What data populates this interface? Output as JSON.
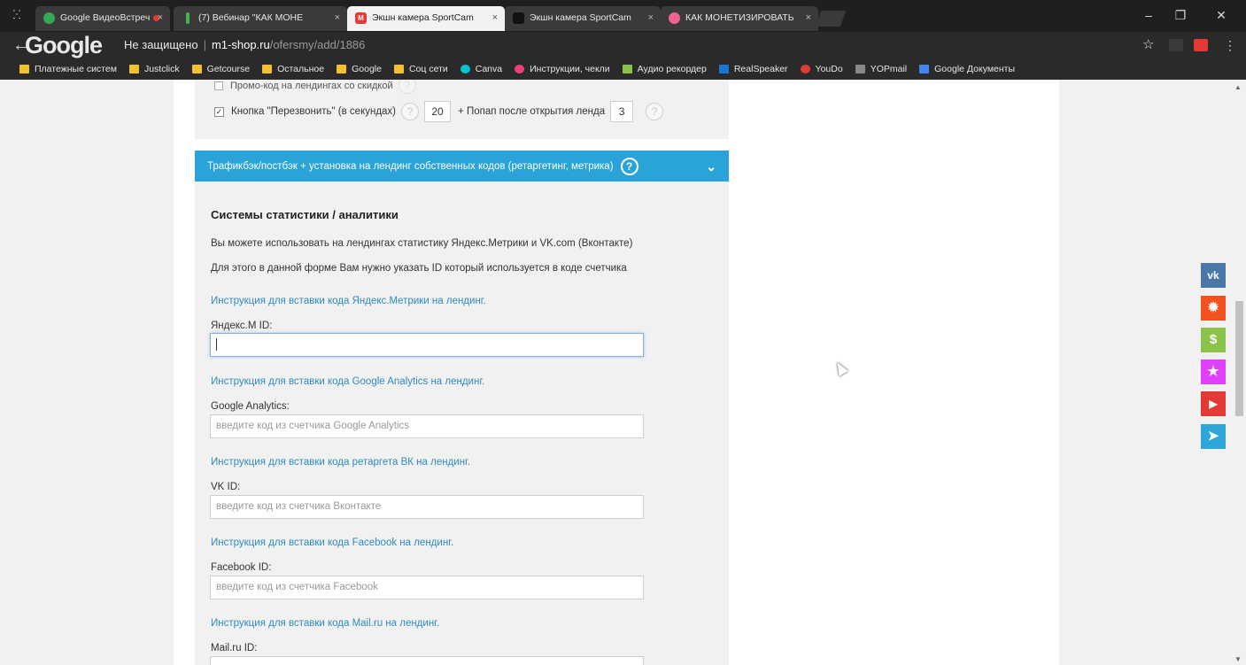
{
  "browser": {
    "tabs": [
      {
        "title": "Google ВидеоВстреч",
        "favicon_color": "#34a853",
        "recording": true
      },
      {
        "title": "(7) Вебинар \"КАК МОНЕ",
        "favicon_color": "#4caf50",
        "recording": false
      },
      {
        "title": "Экшн камера SportCam",
        "favicon_color": "#e53935",
        "favicon_text": "M",
        "recording": false
      },
      {
        "title": "Экшн камера SportCam",
        "favicon_color": "#222222",
        "recording": false
      },
      {
        "title": "КАК МОНЕТИЗИРОВАТЬ",
        "favicon_color": "#f06292",
        "recording": false
      }
    ],
    "active_tab_index": 2,
    "address": {
      "security": "Не защищено",
      "host": "m1-shop.ru",
      "path": "/ofersmy/add/1886"
    },
    "bookmarks": [
      {
        "label": "Платежные систем"
      },
      {
        "label": "Justclick"
      },
      {
        "label": "Getcourse"
      },
      {
        "label": "Остальное"
      },
      {
        "label": "Google"
      },
      {
        "label": "Соц сети"
      },
      {
        "label": "Canva",
        "color": "#00c4cc"
      },
      {
        "label": "Инструкции, чекли",
        "color": "#ec407a"
      },
      {
        "label": "Аудио рекордер",
        "color": "#8bc34a"
      },
      {
        "label": "RealSpeaker",
        "color": "#1976d2"
      },
      {
        "label": "YouDo",
        "color": "#e53935"
      },
      {
        "label": "YOPmail",
        "color": "#888888"
      },
      {
        "label": "Google Документы",
        "color": "#4285f4"
      }
    ]
  },
  "page": {
    "promo_label": "Промо-код на лендингах со скидкой",
    "callback": {
      "label": "Кнопка \"Перезвонить\" (в секундах)",
      "seconds": "20",
      "popup_label": "+ Попап после открытия лендa",
      "popup_value": "3"
    },
    "accordion_title": "Трафикбэк/постбэк + установка на лендинг собственных кодов (ретаргетинг, метрика)",
    "section_title": "Системы статистики / аналитики",
    "paragraphs": [
      "Вы можете использовать на лендингах статистику Яндекс.Метрики и VK.com (Вконтакте)",
      "Для этого в данной форме Вам нужно указать ID который используется в коде счетчика"
    ],
    "fields": [
      {
        "instruction": "Инструкция для вставки кода Яндекс.Метрики на лендинг.",
        "label": "Яндекс.М ID:",
        "value": "",
        "placeholder": ""
      },
      {
        "instruction": "Инструкция для вставки кода Google Analytics на лендинг.",
        "label": "Google Analytics:",
        "value": "",
        "placeholder": "введите код из счетчика Google Analytics"
      },
      {
        "instruction": "Инструкция для вставки кода ретаргета ВК на лендинг.",
        "label": "VK ID:",
        "value": "",
        "placeholder": "введите код из счетчика Вконтакте"
      },
      {
        "instruction": "Инструкция для вставки кода Facebook на лендинг.",
        "label": "Facebook ID:",
        "value": "",
        "placeholder": "введите код из счетчика Facebook"
      },
      {
        "instruction": "Инструкция для вставки кода Mail.ru на лендинг.",
        "label": "Mail.ru ID:",
        "value": "",
        "placeholder": ""
      }
    ]
  },
  "social": [
    {
      "name": "vk",
      "glyph": "vk",
      "color": "#4a76a8"
    },
    {
      "name": "settings",
      "glyph": "✹",
      "color": "#f4511e"
    },
    {
      "name": "money",
      "glyph": "$",
      "color": "#8bc34a"
    },
    {
      "name": "star",
      "glyph": "★",
      "color": "#e040fb"
    },
    {
      "name": "youtube",
      "glyph": "▶",
      "color": "#e53935"
    },
    {
      "name": "telegram",
      "glyph": "➤",
      "color": "#2ea6da"
    }
  ]
}
